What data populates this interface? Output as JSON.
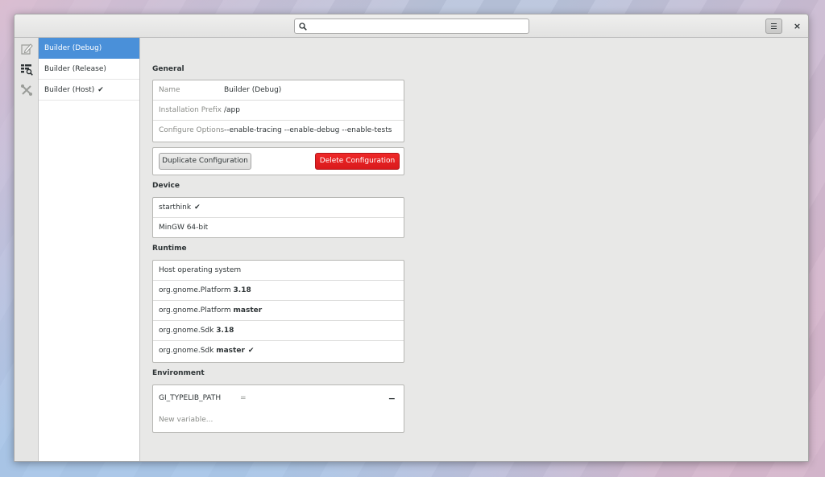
{
  "header": {
    "search": {
      "placeholder": "",
      "value": ""
    },
    "menu_icon": "hamburger-icon",
    "close_label": "×"
  },
  "iconbar": {
    "items": [
      {
        "icon": "edit-document-icon"
      },
      {
        "icon": "build-configuration-icon"
      },
      {
        "icon": "tools-icon"
      }
    ]
  },
  "sidebar": {
    "items": [
      {
        "label": "Builder (Debug)",
        "selected": true,
        "active": false
      },
      {
        "label": "Builder (Release)",
        "selected": false,
        "active": false
      },
      {
        "label": "Builder (Host)",
        "selected": false,
        "active": true,
        "check": "✔"
      }
    ]
  },
  "general": {
    "title": "General",
    "name_label": "Name",
    "name_value": "Builder (Debug)",
    "prefix_label": "Installation Prefix",
    "prefix_value": "/app",
    "options_label": "Configure Options",
    "options_value": "--enable-tracing --enable-debug --enable-tests",
    "duplicate_label": "Duplicate Configuration",
    "delete_label": "Delete Configuration"
  },
  "device": {
    "title": "Device",
    "items": [
      {
        "label": "starthink",
        "check": "✔"
      },
      {
        "label": "MinGW 64-bit",
        "check": ""
      }
    ]
  },
  "runtime": {
    "title": "Runtime",
    "items": [
      {
        "name": "Host operating system",
        "version": "",
        "check": ""
      },
      {
        "name": "org.gnome.Platform",
        "version": "3.18",
        "check": ""
      },
      {
        "name": "org.gnome.Platform",
        "version": "master",
        "check": ""
      },
      {
        "name": "org.gnome.Sdk",
        "version": "3.18",
        "check": ""
      },
      {
        "name": "org.gnome.Sdk",
        "version": "master",
        "check": "✔"
      }
    ]
  },
  "environment": {
    "title": "Environment",
    "variables": [
      {
        "key": "GI_TYPELIB_PATH",
        "eq": "=",
        "value": "",
        "remove": "−"
      }
    ],
    "new_placeholder": "New variable..."
  },
  "colors": {
    "selection": "#4a90d9",
    "destructive": "#ef2929",
    "window_bg": "#e8e8e7"
  }
}
